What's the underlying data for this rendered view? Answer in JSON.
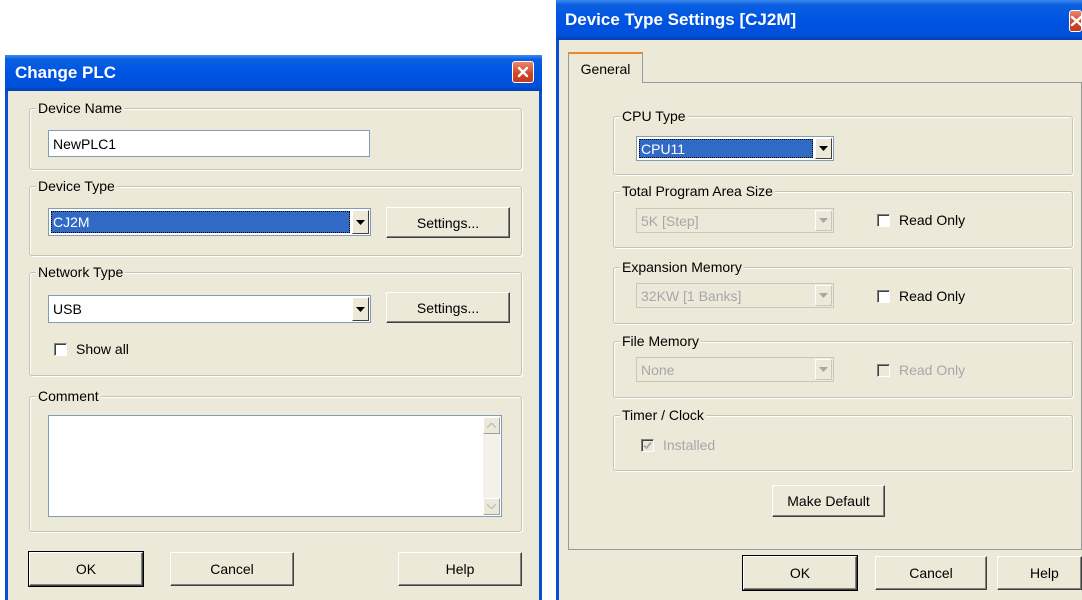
{
  "change_plc": {
    "title": "Change PLC",
    "device_name": {
      "label": "Device Name",
      "value": "NewPLC1"
    },
    "device_type": {
      "label": "Device Type",
      "value": "CJ2M",
      "settings_label": "Settings..."
    },
    "network_type": {
      "label": "Network Type",
      "value": "USB",
      "settings_label": "Settings...",
      "show_all_label": "Show all"
    },
    "comment": {
      "label": "Comment",
      "value": ""
    },
    "buttons": {
      "ok": "OK",
      "cancel": "Cancel",
      "help": "Help"
    }
  },
  "device_type_settings": {
    "title": "Device Type Settings [CJ2M]",
    "tab_general": "General",
    "cpu_type": {
      "label": "CPU Type",
      "value": "CPU11"
    },
    "program_area": {
      "label": "Total Program Area Size",
      "value": "5K [Step]",
      "read_only_label": "Read Only"
    },
    "expansion_memory": {
      "label": "Expansion Memory",
      "value": "32KW [1 Banks]",
      "read_only_label": "Read Only"
    },
    "file_memory": {
      "label": "File Memory",
      "value": "None",
      "read_only_label": "Read Only"
    },
    "timer_clock": {
      "label": "Timer / Clock",
      "installed_label": "Installed",
      "installed_checked": true
    },
    "make_default_label": "Make Default",
    "buttons": {
      "ok": "OK",
      "cancel": "Cancel",
      "help": "Help"
    }
  },
  "colors": {
    "titlebar": "#0054e3",
    "dialog_bg": "#ece9d8",
    "selection": "#316ac5",
    "close_button": "#d04424"
  }
}
